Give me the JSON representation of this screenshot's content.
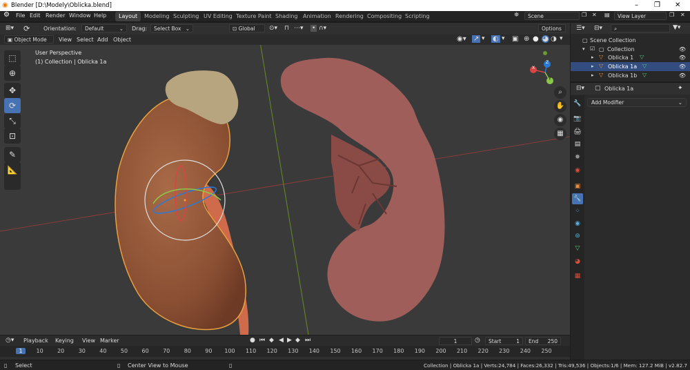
{
  "window": {
    "title": "Blender [D:\\Modely\\Oblicka.blend]",
    "minimize": "–",
    "maximize": "❐",
    "close": "✕"
  },
  "menu": [
    "File",
    "Edit",
    "Render",
    "Window",
    "Help"
  ],
  "workspaces": [
    "Layout",
    "Modeling",
    "Sculpting",
    "UV Editing",
    "Texture Paint",
    "Shading",
    "Animation",
    "Rendering",
    "Compositing",
    "Scripting"
  ],
  "active_workspace": "Layout",
  "scene": {
    "name": "Scene",
    "view_layer": "View Layer"
  },
  "header": {
    "orientation_label": "Orientation:",
    "orientation_value": "Default",
    "drag_label": "Drag:",
    "drag_value": "Select Box",
    "transform_orientation": "Global",
    "options": "Options"
  },
  "viewport_header": {
    "mode": "Object Mode",
    "menus": [
      "View",
      "Select",
      "Add",
      "Object"
    ]
  },
  "viewport": {
    "perspective": "User Perspective",
    "collection": "(1) Collection | Oblicka 1a"
  },
  "gizmo": {
    "x": "X",
    "y": "Y",
    "z": "Z"
  },
  "timeline": {
    "menus": [
      "Playback",
      "Keying",
      "View",
      "Marker"
    ],
    "current_frame": "1",
    "start_label": "Start",
    "start": "1",
    "end_label": "End",
    "end": "250",
    "ticks": [
      "1",
      "10",
      "20",
      "30",
      "40",
      "50",
      "60",
      "70",
      "80",
      "90",
      "100",
      "110",
      "120",
      "130",
      "140",
      "150",
      "160",
      "170",
      "180",
      "190",
      "200",
      "210",
      "220",
      "230",
      "240",
      "250"
    ]
  },
  "status": {
    "left": "Select",
    "middle": "Center View to Mouse",
    "right": "Collection | Oblicka 1a | Verts:24,784 | Faces:26,332 | Tris:49,536 | Objects:1/6 | Mem: 127.2 MiB | v2.82.7"
  },
  "outliner": {
    "root": "Scene Collection",
    "collection": "Collection",
    "items": [
      {
        "label": "Oblicka 1",
        "selected": false
      },
      {
        "label": "Oblicka 1a",
        "selected": true
      },
      {
        "label": "Oblicka 1b",
        "selected": false
      }
    ]
  },
  "properties": {
    "object": "Oblicka 1a",
    "add_modifier": "Add Modifier"
  },
  "colors": {
    "accent": "#4772b3",
    "selection": "#334d80",
    "viewport": "#3a3a3a",
    "kidney_left": "#9a5a3c",
    "kidney_right": "#a05e5b",
    "adrenal": "#b7a57f",
    "ureter": "#cf6a4a"
  }
}
